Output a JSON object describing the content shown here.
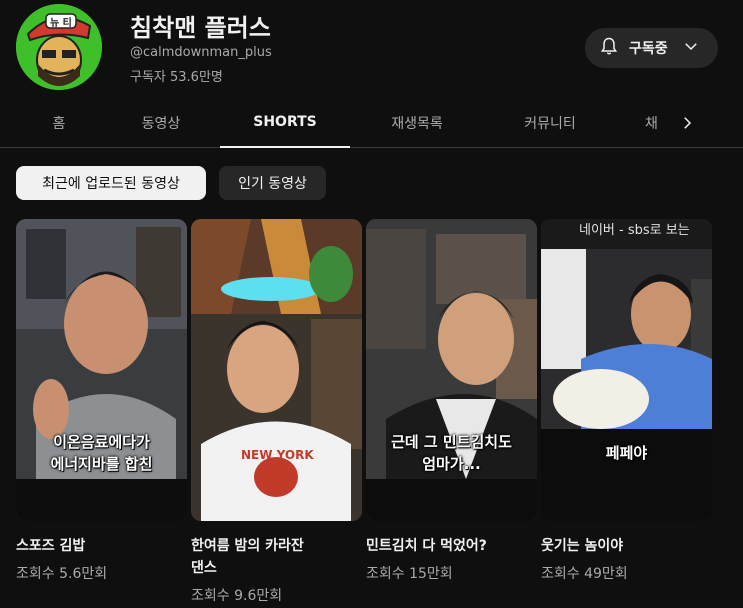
{
  "channel": {
    "title": "침착맨 플러스",
    "handle": "@calmdownman_plus",
    "subscribers": "구독자 53.6만명",
    "subscribe_label": "구독중",
    "avatar_text": "뉴 티"
  },
  "tabs": [
    {
      "label": "홈"
    },
    {
      "label": "동영상"
    },
    {
      "label": "SHORTS"
    },
    {
      "label": "재생목록"
    },
    {
      "label": "커뮤니티"
    },
    {
      "label": "채"
    }
  ],
  "chips": [
    {
      "label": "최근에 업로드된 동영상"
    },
    {
      "label": "인기 동영상"
    }
  ],
  "shorts": [
    {
      "caption_lines": [
        "이온음료에다가",
        "에너지바를 합친"
      ],
      "title_lines": [
        "스포즈 김밥"
      ],
      "views": "조회수 5.6만회",
      "top_text": ""
    },
    {
      "caption_lines": [],
      "title_lines": [
        "한여름 밤의 카라잔",
        "댄스"
      ],
      "views": "조회수 9.6만회",
      "top_text": ""
    },
    {
      "caption_lines": [
        "근데 그 민트김치도",
        "엄마가..."
      ],
      "title_lines": [
        "민트김치 다 먹었어?"
      ],
      "views": "조회수 15만회",
      "top_text": ""
    },
    {
      "caption_lines": [
        "페페야"
      ],
      "title_lines": [
        "웃기는 놈이야"
      ],
      "views": "조회수 49만회",
      "top_text": "네이버 - sbs로 보는"
    }
  ],
  "colors": {
    "background": "#0f0f0f",
    "chip_selected": "#f1f1f1",
    "chip": "#272727"
  }
}
